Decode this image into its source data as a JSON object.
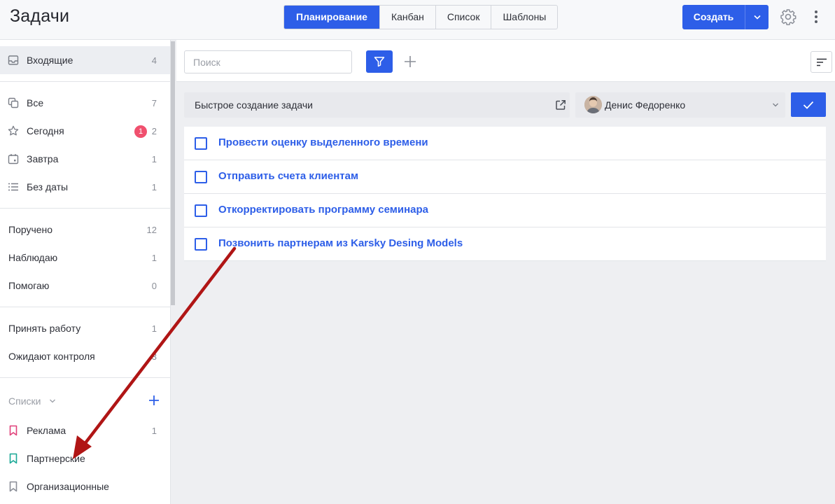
{
  "header": {
    "title": "Задачи",
    "tabs": [
      {
        "label": "Планирование",
        "active": true
      },
      {
        "label": "Канбан",
        "active": false
      },
      {
        "label": "Список",
        "active": false
      },
      {
        "label": "Шаблоны",
        "active": false
      }
    ],
    "create_label": "Создать",
    "icons": {
      "split": "chevron-down-icon",
      "settings": "gear-icon",
      "more": "kebab-menu-icon"
    }
  },
  "sidebar": {
    "inbox": {
      "label": "Входящие",
      "count": "4",
      "icon": "inbox-icon"
    },
    "smart": [
      {
        "label": "Все",
        "count": "7",
        "icon": "copy-icon"
      },
      {
        "label": "Сегодня",
        "count": "2",
        "badge": "1",
        "icon": "star-icon"
      },
      {
        "label": "Завтра",
        "count": "1",
        "icon": "calendar-icon"
      },
      {
        "label": "Без даты",
        "count": "1",
        "icon": "list-icon"
      }
    ],
    "roles": [
      {
        "label": "Поручено",
        "count": "12"
      },
      {
        "label": "Наблюдаю",
        "count": "1"
      },
      {
        "label": "Помогаю",
        "count": "0"
      }
    ],
    "control": [
      {
        "label": "Принять работу",
        "count": "1"
      },
      {
        "label": "Ожидают контроля",
        "count": "3"
      }
    ],
    "lists_title": "Списки",
    "lists": [
      {
        "label": "Реклама",
        "count": "1",
        "color": "#e0417a"
      },
      {
        "label": "Партнерские",
        "count": "",
        "color": "#1aa896"
      },
      {
        "label": "Организационные",
        "count": "",
        "color": "#8a8e97"
      }
    ]
  },
  "toolbar": {
    "search_placeholder": "Поиск",
    "icons": {
      "filter": "filter-icon",
      "add": "plus-icon",
      "sort": "sort-icon"
    }
  },
  "quick_create": {
    "placeholder": "Быстрое создание задачи",
    "assignee": "Денис Федоренко",
    "icons": {
      "open": "external-link-icon",
      "confirm": "check-icon"
    }
  },
  "tasks": [
    {
      "title": "Провести оценку выделенного времени"
    },
    {
      "title": "Отправить счета клиентам"
    },
    {
      "title": "Откорректировать программу семинара"
    },
    {
      "title": "Позвонить партнерам из Karsky Desing Models"
    }
  ],
  "colors": {
    "accent": "#2d5ee8",
    "annotation_arrow": "#b01515",
    "badge": "#f0506e"
  }
}
